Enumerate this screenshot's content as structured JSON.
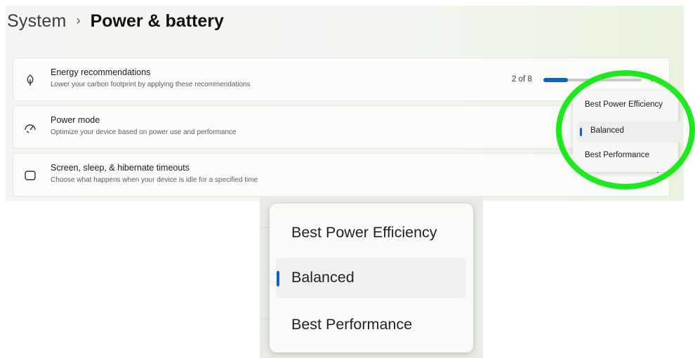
{
  "breadcrumb": {
    "root": "System",
    "separator": "›",
    "current": "Power & battery"
  },
  "cards": {
    "energy": {
      "icon": "leaf-icon",
      "title": "Energy recommendations",
      "description": "Lower your carbon footprint by applying these recommendations",
      "progress_text": "2 of 8",
      "progress_fraction": 0.25
    },
    "power_mode": {
      "icon": "speedometer-icon",
      "title": "Power mode",
      "description": "Optimize your device based on power use and performance"
    },
    "sleep": {
      "icon": "sleep-timer-icon",
      "title": "Screen, sleep, & hibernate timeouts",
      "description": "Choose what happens when your device is idle for a specified time"
    }
  },
  "power_mode_menu": {
    "options": [
      "Best Power Efficiency",
      "Balanced",
      "Best Performance"
    ],
    "selected": "Balanced"
  },
  "colors": {
    "accent": "#0a64c2",
    "highlight_ring": "#1ee81e"
  }
}
